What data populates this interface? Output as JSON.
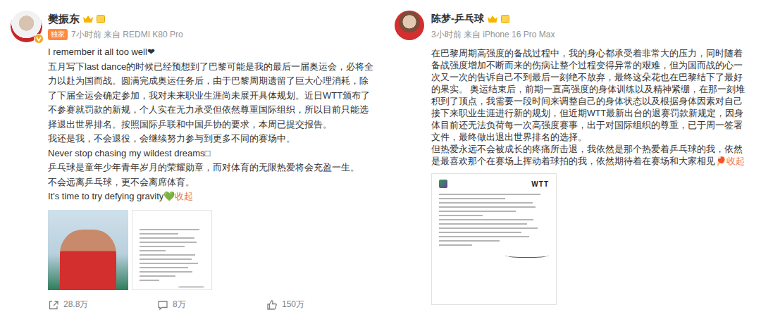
{
  "posts": [
    {
      "author": "樊振东",
      "tag": "独家",
      "meta": "7小时前 来自 REDMI K80 Pro",
      "paragraphs": [
        "I remember it all too well❤",
        "五月写下last dance的时候已经预想到了巴黎可能是我的最后一届奥运会，必将全力以赴为国而战。圆满完成奥运任务后，由于巴黎周期遗留了巨大心理消耗，除了下届全运会确定参加，我对未来职业生涯尚未展开具体规划。近日WTT颁布了不参赛就罚款的新规，个人实在无力承受但依然尊重国际组织，所以目前只能选择退出世界排名。按照国际乒联和中国乒协的要求，本周已提交报告。",
        "我还是我，不会退役，会继续努力参与到更多不同的赛场中。",
        "Never stop chasing my wildest dreams□",
        "乒乓球是童年少年青年岁月的荣耀勋章，而对体育的无限热爱将会充盈一生。",
        "不会远离乒乓球，更不会离席体育。",
        "It's time to try defying gravity💚"
      ],
      "collapse": "收起",
      "images": [
        {
          "kind": "photo"
        },
        {
          "kind": "document"
        }
      ],
      "stats": [
        {
          "kind": "share",
          "count": "28.8万"
        },
        {
          "kind": "comment",
          "count": "8万"
        },
        {
          "kind": "like",
          "count": "150万"
        }
      ]
    },
    {
      "author": "陈梦-乒乓球",
      "meta": "3小时前 来自 iPhone 16 Pro Max",
      "paragraphs": [
        "在巴黎周期高强度的备战过程中，我的身心都承受着非常大的压力，同时随着备战强度增加不断而来的伤病让整个过程变得异常的艰难，但为国而战的心一次又一次的告诉自己不到最后一刻绝不放弃，最终这朵花也在巴黎结下了最好的果实。 奥运结束后，前期一直高强度的身体训练以及精神紧绷，在那一刻堆积到了顶点，我需要一段时间来调整自己的身体状态以及根据身体因素对自己接下来职业生涯进行新的规划，但近期WTT最新出台的退赛罚款新规定，因身体目前还无法负荷每一次高强度赛事，出于对国际组织的尊重，已于周一签署文件，最终做出退出世界排名的选择。",
        "但热爱永远不会被成长的疼痛所击退，我依然是那个热爱着乒乓球的我，依然是最喜欢那个在赛场上挥动着球拍的我，依然期待着在赛场和大家相见🏓"
      ],
      "collapse": "收起",
      "images": [
        {
          "kind": "document",
          "logo": "WTT"
        }
      ],
      "stats": []
    }
  ]
}
